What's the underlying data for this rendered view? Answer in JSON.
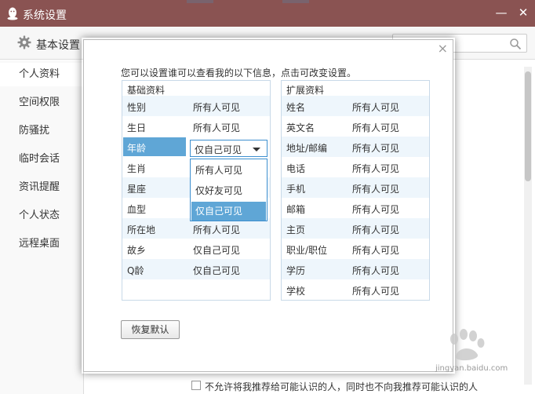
{
  "window": {
    "title": "系统设置",
    "minimize_glyph": "—",
    "close_glyph": "✕"
  },
  "header": {
    "heading": "基本设置",
    "search_placeholder": ""
  },
  "sidebar": {
    "items": [
      {
        "label": "个人资料",
        "active": true
      },
      {
        "label": "空间权限"
      },
      {
        "label": "防骚扰"
      },
      {
        "label": "临时会话"
      },
      {
        "label": "资讯提醒"
      },
      {
        "label": "个人状态"
      },
      {
        "label": "远程桌面"
      }
    ]
  },
  "bottom": {
    "checkbox_label": "不允许将我推荐给可能认识的人，同时也不向我推荐可能认识的人"
  },
  "modal": {
    "close_glyph": "×",
    "hint": "您可以设置谁可以查看我的以下信息，点击可改变设置。",
    "basic": {
      "title": "基础资料",
      "rows": [
        {
          "key": "性别",
          "value": "所有人可见"
        },
        {
          "key": "生日",
          "value": "所有人可见"
        },
        {
          "key": "年龄",
          "value": "仅自己可见"
        },
        {
          "key": "生肖",
          "value": ""
        },
        {
          "key": "星座",
          "value": ""
        },
        {
          "key": "血型",
          "value": ""
        },
        {
          "key": "所在地",
          "value": "所有人可见"
        },
        {
          "key": "故乡",
          "value": "仅自己可见"
        },
        {
          "key": "Q龄",
          "value": "仅自己可见"
        }
      ]
    },
    "extended": {
      "title": "扩展资料",
      "rows": [
        {
          "key": "姓名",
          "value": "所有人可见"
        },
        {
          "key": "英文名",
          "value": "所有人可见"
        },
        {
          "key": "地址/邮编",
          "value": "所有人可见"
        },
        {
          "key": "电话",
          "value": "所有人可见"
        },
        {
          "key": "手机",
          "value": "所有人可见"
        },
        {
          "key": "邮箱",
          "value": "所有人可见"
        },
        {
          "key": "主页",
          "value": "所有人可见"
        },
        {
          "key": "职业/职位",
          "value": "所有人可见"
        },
        {
          "key": "学历",
          "value": "所有人可见"
        },
        {
          "key": "学校",
          "value": "所有人可见"
        }
      ]
    },
    "age_select": {
      "value": "仅自己可见",
      "options": [
        "所有人可见",
        "仅好友可见",
        "仅自己可见"
      ],
      "active_index": 2
    },
    "reset_label": "恢复默认"
  },
  "watermark": {
    "text": "jingyan.baidu.com"
  },
  "colors": {
    "titlebar": "#8a5352",
    "accent": "#5fa6d6",
    "select_border": "#3d8fcf",
    "row_alt": "#eef6fc"
  }
}
